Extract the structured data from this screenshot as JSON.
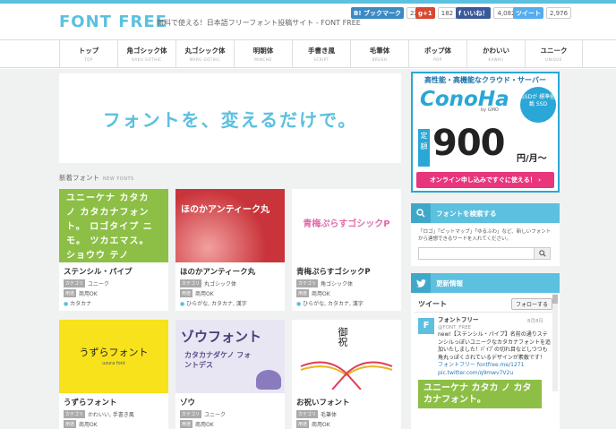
{
  "header": {
    "logo": "FONT FREE",
    "tagline": "無料で使える！日本語フリーフォント投稿サイト - FONT FREE",
    "hatena_label": "B! ブックマーク",
    "hatena_count": "2203",
    "gplus_label": "g+1",
    "gplus_count": "182",
    "fb_label": "f いいね！",
    "fb_count": "4,082",
    "tw_label": "ツイート",
    "tw_count": "2,976"
  },
  "nav": [
    {
      "jp": "トップ",
      "en": "TOP"
    },
    {
      "jp": "角ゴシック体",
      "en": "KAKU GOTHIC"
    },
    {
      "jp": "丸ゴシック体",
      "en": "MARU GOTHIC"
    },
    {
      "jp": "明朝体",
      "en": "MINCHO"
    },
    {
      "jp": "手書き風",
      "en": "SCRIPT"
    },
    {
      "jp": "毛筆体",
      "en": "BRUSH"
    },
    {
      "jp": "ポップ体",
      "en": "POP"
    },
    {
      "jp": "かわいい",
      "en": "KAWAII"
    },
    {
      "jp": "ユニーク",
      "en": "UNIQUE"
    }
  ],
  "hero": {
    "text": "フォントを、変えるだけで。"
  },
  "section": {
    "title": "新着フォント",
    "en": "NEW FONTS"
  },
  "category_tag": "カテゴリ",
  "usage_tag": "用途",
  "cards": [
    {
      "title": "ステンシル・パイプ",
      "category": "ユニーク",
      "usage": "商用OK",
      "keywords": "カタカナ",
      "thumb_text": "ユニーケナ カタカ ノ カタカナフォント。 ロゴタイプ ニモ。 ツカエマス。 ショウウ テノ",
      "thumb_bg": "#8dbf46"
    },
    {
      "title": "ほのかアンティーク丸",
      "category": "丸ゴシック体",
      "usage": "商用OK",
      "keywords": "ひらがな, カタカナ, 漢字",
      "thumb_text": "ほのかアンティーク丸",
      "thumb_bg": "#c9343a"
    },
    {
      "title": "青梅ぷらすゴシックP",
      "category": "角ゴシック体",
      "usage": "商用OK",
      "keywords": "ひらがな, カタカナ, 漢字",
      "thumb_text": "青梅ぷらすゴシックP",
      "thumb_bg": "#ffffff"
    },
    {
      "title": "うずらフォント",
      "category": "かわいい, 手書き風",
      "usage": "商用OK",
      "keywords": "",
      "thumb_text": "うずらフォント",
      "thumb_sub": "uzura font",
      "thumb_bg": "#f7e21b"
    },
    {
      "title": "ゾウ",
      "category": "ユニーク",
      "usage": "商用OK",
      "keywords": "",
      "thumb_text": "ゾウフォント",
      "thumb_sub": "カタカナダケノ フォントデス",
      "thumb_bg": "#e8e6f2"
    },
    {
      "title": "お祝いフォント",
      "category": "毛筆体",
      "usage": "商用OK",
      "keywords": "",
      "thumb_text": "御祝",
      "thumb_bg": "#ffffff"
    }
  ],
  "ad": {
    "line1": "高性能・高機能なクラウド・サーバー",
    "brand": "ConoHa",
    "bygmo": "by GMO",
    "badge": "SSDが 標準搭載 SSD",
    "teigaku": "定額",
    "price": "900",
    "unit": "円/月〜",
    "cta": "オンライン申し込みですぐに使える！ ›"
  },
  "search": {
    "title": "フォントを検索する",
    "desc": "「ロゴ」「ピットマップ」「ゆるふわ」など、新しいフォントから連想できるワードを入れてください。"
  },
  "news": {
    "title": "更新情報",
    "tweets_label": "ツイート",
    "follow_label": "フォローする",
    "tweet_name": "フォントフリー",
    "tweet_handle": "@FONT_FREE",
    "tweet_date": "8月8日",
    "tweet_text": "new!【ステンシル・パイプ】名前の通りステンシルっぽいユニークなカタカナフォントを追加いたしました！ﾊﾟｲﾌﾟの切れ目などしつつも角丸っぽくされているデザインが素敵です！",
    "tweet_link1": "フォントフリー fontfree.me/1271",
    "tweet_link2": "pic.twitter.com/q9mwv7V2u",
    "tweet_thumb": "ユニーケナ カタカ ノ カタカナフォント。"
  }
}
